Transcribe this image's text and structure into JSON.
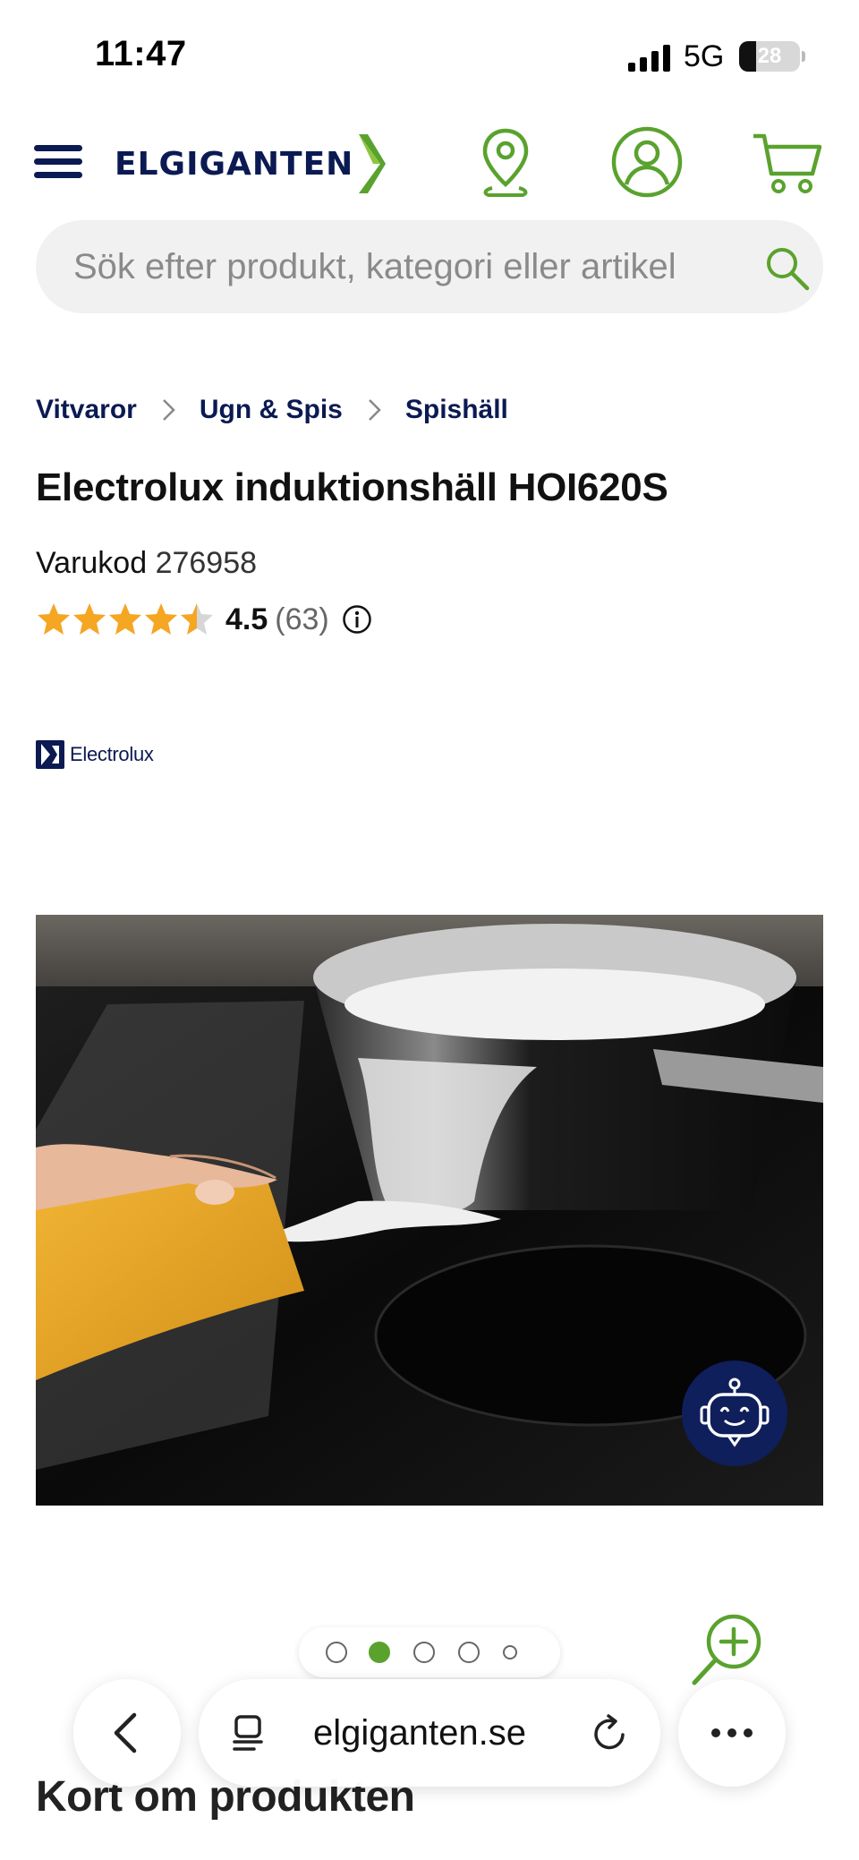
{
  "status_bar": {
    "time": "11:47",
    "network": "5G",
    "battery": "28",
    "battery_level": 0.28
  },
  "header": {
    "logo_text": "ELGIGANTEN",
    "brand_color": "#0b1a52",
    "accent_color": "#5aa22e"
  },
  "search": {
    "placeholder": "Sök efter produkt, kategori eller artikel"
  },
  "breadcrumb": [
    "Vitvaror",
    "Ugn & Spis",
    "Spishäll"
  ],
  "product": {
    "title": "Electrolux induktionshäll HOI620S",
    "sku_label": "Varukod",
    "sku": "276958",
    "rating": "4.5",
    "rating_count": "(63)",
    "rating_value": 4.5,
    "brand": "Electrolux"
  },
  "carousel": {
    "count": 5,
    "active_index": 1
  },
  "section": {
    "heading": "Kort om produkten"
  },
  "browser": {
    "url": "elgiganten.se"
  }
}
